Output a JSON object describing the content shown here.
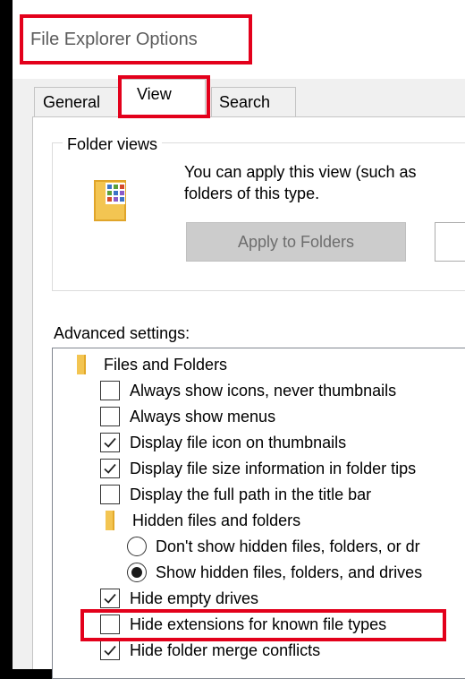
{
  "window": {
    "title": "File Explorer Options"
  },
  "tabs": [
    {
      "label": "General"
    },
    {
      "label": "View",
      "selected": true
    },
    {
      "label": "Search"
    }
  ],
  "folder_views": {
    "label": "Folder views",
    "description_line1": "You can apply this view (such as",
    "description_line2": "folders of this type.",
    "apply_button": "Apply to Folders"
  },
  "advanced": {
    "label": "Advanced settings:",
    "items": [
      {
        "type": "folder",
        "label": "Files and Folders"
      },
      {
        "type": "checkbox",
        "label": "Always show icons, never thumbnails",
        "checked": false
      },
      {
        "type": "checkbox",
        "label": "Always show menus",
        "checked": false
      },
      {
        "type": "checkbox",
        "label": "Display file icon on thumbnails",
        "checked": true
      },
      {
        "type": "checkbox",
        "label": "Display file size information in folder tips",
        "checked": true
      },
      {
        "type": "checkbox",
        "label": "Display the full path in the title bar",
        "checked": false
      },
      {
        "type": "folder",
        "label": "Hidden files and folders"
      },
      {
        "type": "radio",
        "label": "Don't show hidden files, folders, or dr",
        "checked": false
      },
      {
        "type": "radio",
        "label": "Show hidden files, folders, and drives",
        "checked": true
      },
      {
        "type": "checkbox",
        "label": "Hide empty drives",
        "checked": true
      },
      {
        "type": "checkbox",
        "label": "Hide extensions for known file types",
        "checked": false
      },
      {
        "type": "checkbox",
        "label": "Hide folder merge conflicts",
        "checked": true
      }
    ]
  },
  "colors": {
    "highlight": "#e3001b",
    "folder": "#f3c552"
  }
}
